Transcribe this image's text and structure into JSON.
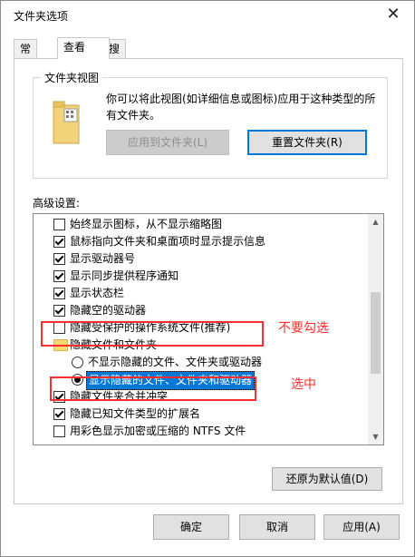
{
  "window": {
    "title": "文件夹选项"
  },
  "tabs": [
    {
      "label": "常规"
    },
    {
      "label": "查看"
    },
    {
      "label": "搜索"
    }
  ],
  "folder_views": {
    "legend": "文件夹视图",
    "description": "你可以将此视图(如详细信息或图标)应用于这种类型的所有文件夹。",
    "apply_button": "应用到文件夹(L)",
    "reset_button": "重置文件夹(R)"
  },
  "advanced": {
    "label": "高级设置:",
    "items": [
      {
        "kind": "checkbox",
        "checked": false,
        "label": "始终显示图标，从不显示缩略图"
      },
      {
        "kind": "checkbox",
        "checked": true,
        "label": "鼠标指向文件夹和桌面项时显示提示信息"
      },
      {
        "kind": "checkbox",
        "checked": true,
        "label": "显示驱动器号"
      },
      {
        "kind": "checkbox",
        "checked": true,
        "label": "显示同步提供程序通知"
      },
      {
        "kind": "checkbox",
        "checked": true,
        "label": "显示状态栏"
      },
      {
        "kind": "checkbox",
        "checked": true,
        "label": "隐藏空的驱动器"
      },
      {
        "kind": "checkbox",
        "checked": false,
        "label": "隐藏受保护的操作系统文件(推荐)"
      },
      {
        "kind": "folder",
        "label": "隐藏文件和文件夹"
      },
      {
        "kind": "radio",
        "checked": false,
        "label": "不显示隐藏的文件、文件夹或驱动器"
      },
      {
        "kind": "radio",
        "checked": true,
        "label": "显示隐藏的文件、文件夹和驱动器"
      },
      {
        "kind": "checkbox",
        "checked": true,
        "label": "隐藏文件夹合并冲突"
      },
      {
        "kind": "checkbox",
        "checked": true,
        "label": "隐藏已知文件类型的扩展名"
      },
      {
        "kind": "checkbox",
        "checked": false,
        "label": "用彩色显示加密或压缩的 NTFS 文件"
      }
    ]
  },
  "restore_defaults": "还原为默认值(D)",
  "footer": {
    "ok": "确定",
    "cancel": "取消",
    "apply": "应用(A)"
  },
  "annotations": {
    "do_not_check": "不要勾选",
    "select": "选中"
  },
  "colors": {
    "accent": "#0078d7",
    "annotation": "#ff2d2d"
  }
}
